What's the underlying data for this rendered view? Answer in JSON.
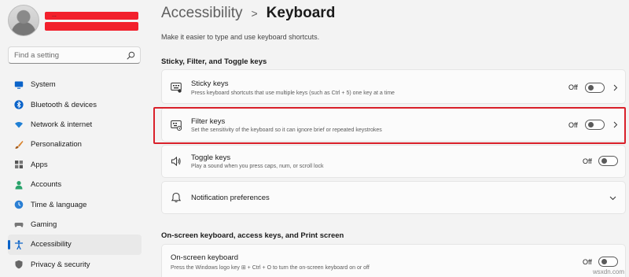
{
  "sidebar": {
    "profile": {
      "name_fragment": "..."
    },
    "search": {
      "placeholder": "Find a setting",
      "icon": "search-icon"
    },
    "items": [
      {
        "label": "System",
        "icon": "monitor-icon",
        "color": "#0a63c9"
      },
      {
        "label": "Bluetooth & devices",
        "icon": "bluetooth-icon",
        "color": "#0a63c9"
      },
      {
        "label": "Network & internet",
        "icon": "wifi-icon",
        "color": "#1f7fd4"
      },
      {
        "label": "Personalization",
        "icon": "brush-icon",
        "color": "#d9822b"
      },
      {
        "label": "Apps",
        "icon": "apps-icon",
        "color": "#555555"
      },
      {
        "label": "Accounts",
        "icon": "person-icon",
        "color": "#2aa36b"
      },
      {
        "label": "Time & language",
        "icon": "globe-clock-icon",
        "color": "#2a7fd4"
      },
      {
        "label": "Gaming",
        "icon": "gamepad-icon",
        "color": "#777777"
      },
      {
        "label": "Accessibility",
        "icon": "accessibility-icon",
        "color": "#0a63c9",
        "active": true
      },
      {
        "label": "Privacy & security",
        "icon": "shield-icon",
        "color": "#666666"
      }
    ]
  },
  "header": {
    "parent": "Accessibility",
    "separator": ">",
    "current": "Keyboard",
    "subtitle": "Make it easier to type and use keyboard shortcuts."
  },
  "sections": {
    "sticky_filter_toggle": "Sticky, Filter, and Toggle keys",
    "onscreen": "On-screen keyboard, access keys, and Print screen"
  },
  "cards": {
    "sticky": {
      "title": "Sticky keys",
      "description": "Press keyboard shortcuts that use multiple keys (such as Ctrl + 5) one key at a time",
      "state": "Off",
      "on": false,
      "icon": "sticky-keys-icon"
    },
    "filter": {
      "title": "Filter keys",
      "description": "Set the sensitivity of the keyboard so it can ignore brief or repeated keystrokes",
      "state": "Off",
      "on": false,
      "icon": "filter-keys-icon"
    },
    "toggle": {
      "title": "Toggle keys",
      "description": "Play a sound when you press caps, num, or scroll lock",
      "state": "Off",
      "on": false,
      "icon": "speaker-icon"
    },
    "notification": {
      "title": "Notification preferences",
      "icon": "bell-icon"
    },
    "onscreen": {
      "title": "On-screen keyboard",
      "description": "Press the Windows logo key ⊞ + Ctrl + O to turn the on-screen keyboard on or off",
      "state": "Off",
      "on": false
    }
  },
  "colors": {
    "accent": "#0a63c9",
    "highlight_box": "#d9202a",
    "redaction": "#f2202c"
  },
  "watermark": "wsxdn.com"
}
